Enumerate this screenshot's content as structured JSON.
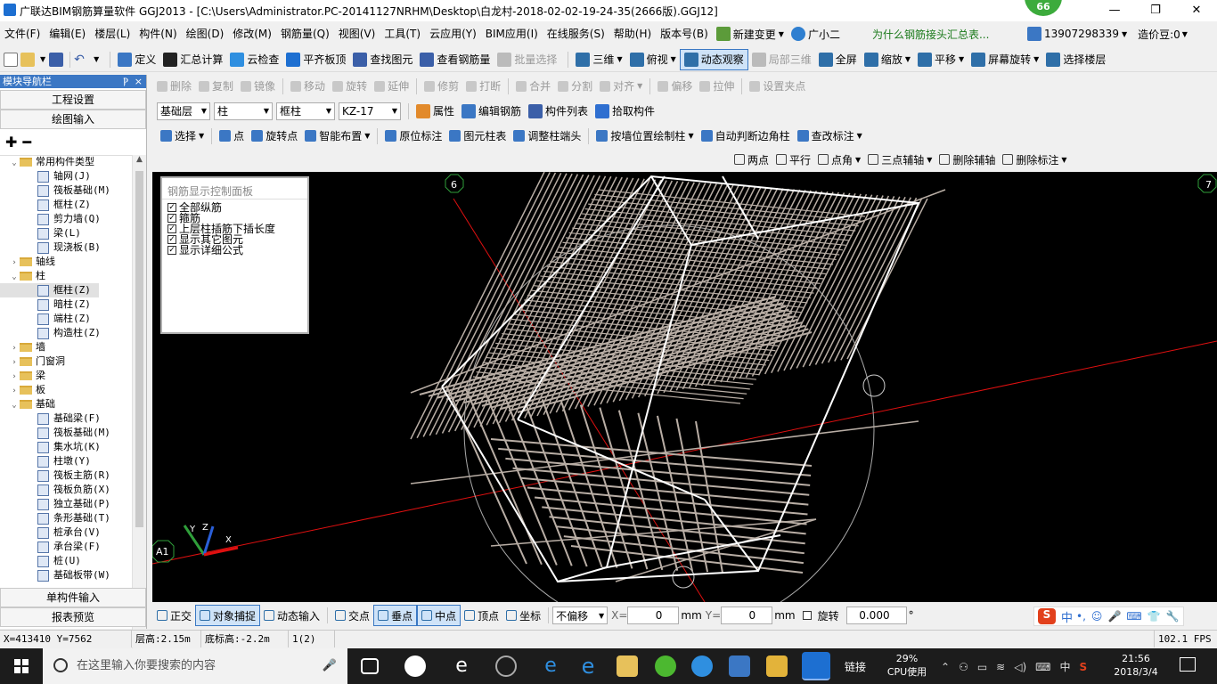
{
  "window": {
    "title": "广联达BIM钢筋算量软件 GGJ2013 - [C:\\Users\\Administrator.PC-20141127NRHM\\Desktop\\白龙村-2018-02-02-19-24-35(2666版).GGJ12]",
    "badge": "66",
    "min": "—",
    "max": "❐",
    "close": "✕"
  },
  "menubar": {
    "items": [
      "文件(F)",
      "编辑(E)",
      "楼层(L)",
      "构件(N)",
      "绘图(D)",
      "修改(M)",
      "钢筋量(Q)",
      "视图(V)",
      "工具(T)",
      "云应用(Y)",
      "BIM应用(I)",
      "在线服务(S)",
      "帮助(H)",
      "版本号(B)"
    ],
    "new_change": "新建变更",
    "assistant": "广小二",
    "marquee": "为什么钢筋接头汇总表...",
    "phone": "13907298339",
    "price": "造价豆:0"
  },
  "toolbar1": {
    "items": [
      "定义",
      "汇总计算",
      "云检查",
      "平齐板顶",
      "查找图元",
      "查看钢筋量",
      "批量选择"
    ],
    "view_items": [
      "三维",
      "俯视",
      "动态观察",
      "局部三维",
      "全屏",
      "缩放",
      "平移",
      "屏幕旋转",
      "选择楼层"
    ]
  },
  "nav": {
    "header": "模块导航栏",
    "pin": "Ⲣ",
    "close": "×",
    "btn_project": "工程设置",
    "btn_draw": "绘图输入",
    "btn_single": "单构件输入",
    "btn_report": "报表预览",
    "tree": [
      {
        "level": 0,
        "exp": "v",
        "type": "folder",
        "label": "常用构件类型"
      },
      {
        "level": 1,
        "type": "icon",
        "label": "轴网(J)"
      },
      {
        "level": 1,
        "type": "icon",
        "label": "筏板基础(M)"
      },
      {
        "level": 1,
        "type": "icon",
        "label": "框柱(Z)"
      },
      {
        "level": 1,
        "type": "icon",
        "label": "剪力墙(Q)"
      },
      {
        "level": 1,
        "type": "icon",
        "label": "梁(L)"
      },
      {
        "level": 1,
        "type": "icon",
        "label": "现浇板(B)"
      },
      {
        "level": 0,
        "exp": ">",
        "type": "folder",
        "label": "轴线"
      },
      {
        "level": 0,
        "exp": "v",
        "type": "folder",
        "label": "柱"
      },
      {
        "level": 1,
        "type": "icon",
        "label": "框柱(Z)",
        "selected": true
      },
      {
        "level": 1,
        "type": "icon",
        "label": "暗柱(Z)"
      },
      {
        "level": 1,
        "type": "icon",
        "label": "端柱(Z)"
      },
      {
        "level": 1,
        "type": "icon",
        "label": "构造柱(Z)"
      },
      {
        "level": 0,
        "exp": ">",
        "type": "folder",
        "label": "墙"
      },
      {
        "level": 0,
        "exp": ">",
        "type": "folder",
        "label": "门窗洞"
      },
      {
        "level": 0,
        "exp": ">",
        "type": "folder",
        "label": "梁"
      },
      {
        "level": 0,
        "exp": ">",
        "type": "folder",
        "label": "板"
      },
      {
        "level": 0,
        "exp": "v",
        "type": "folder",
        "label": "基础"
      },
      {
        "level": 1,
        "type": "icon",
        "label": "基础梁(F)"
      },
      {
        "level": 1,
        "type": "icon",
        "label": "筏板基础(M)"
      },
      {
        "level": 1,
        "type": "icon",
        "label": "集水坑(K)"
      },
      {
        "level": 1,
        "type": "icon",
        "label": "柱墩(Y)"
      },
      {
        "level": 1,
        "type": "icon",
        "label": "筏板主筋(R)"
      },
      {
        "level": 1,
        "type": "icon",
        "label": "筏板负筋(X)"
      },
      {
        "level": 1,
        "type": "icon",
        "label": "独立基础(P)"
      },
      {
        "level": 1,
        "type": "icon",
        "label": "条形基础(T)"
      },
      {
        "level": 1,
        "type": "icon",
        "label": "桩承台(V)"
      },
      {
        "level": 1,
        "type": "icon",
        "label": "承台梁(F)"
      },
      {
        "level": 1,
        "type": "icon",
        "label": "桩(U)"
      },
      {
        "level": 1,
        "type": "icon",
        "label": "基础板带(W)"
      }
    ]
  },
  "edit_toolbar": {
    "items": [
      "删除",
      "复制",
      "镜像",
      "移动",
      "旋转",
      "延伸",
      "修剪",
      "打断",
      "合并",
      "分割",
      "对齐",
      "偏移",
      "拉伸",
      "设置夹点"
    ]
  },
  "prop_toolbar": {
    "floor": "基础层",
    "category": "柱",
    "type": "框柱",
    "name": "KZ-17",
    "items": [
      "属性",
      "编辑钢筋",
      "构件列表",
      "拾取构件"
    ]
  },
  "draw_toolbar": {
    "items": [
      "选择",
      "点",
      "旋转点",
      "智能布置",
      "原位标注",
      "图元柱表",
      "调整柱端头",
      "按墙位置绘制柱",
      "自动判断边角柱",
      "查改标注"
    ]
  },
  "aux_toolbar": {
    "items": [
      "两点",
      "平行",
      "点角",
      "三点辅轴",
      "删除辅轴",
      "删除标注"
    ]
  },
  "viewport": {
    "panel_title": "钢筋显示控制面板",
    "checks": [
      "全部纵筋",
      "箍筋",
      "上层柱插筋下插长度",
      "显示其它图元",
      "显示详细公式"
    ],
    "axis_labels": {
      "a6": "6",
      "a7": "7",
      "a1": "A1"
    },
    "gizmo": {
      "x": "X",
      "y": "Y",
      "z": "Z"
    }
  },
  "bottom_toolbar": {
    "items": [
      "正交",
      "对象捕捉",
      "动态输入",
      "交点",
      "垂点",
      "中点",
      "顶点",
      "坐标"
    ],
    "offset": "不偏移",
    "x_label": "X=",
    "x_val": "0",
    "mm1": "mm",
    "y_label": "Y=",
    "y_val": "0",
    "mm2": "mm",
    "rotate": "旋转",
    "rot_val": "0.000",
    "deg": "°"
  },
  "status": {
    "coords": "X=413410 Y=7562",
    "floor_h": "层高:2.15m",
    "base_h": "底标高:-2.2m",
    "count": "1(2)",
    "fps": "102.1 FPS"
  },
  "taskbar": {
    "search": "在这里输入你要搜索的内容",
    "link": "链接",
    "cpu_pct": "29%",
    "cpu_label": "CPU使用",
    "ime": "中",
    "time": "21:56",
    "date": "2018/3/4"
  },
  "colors": {
    "accent": "#3b77c4",
    "rebar": "#b9aea5",
    "axis_red": "#e01010",
    "axis_green": "#2f9e3a"
  }
}
